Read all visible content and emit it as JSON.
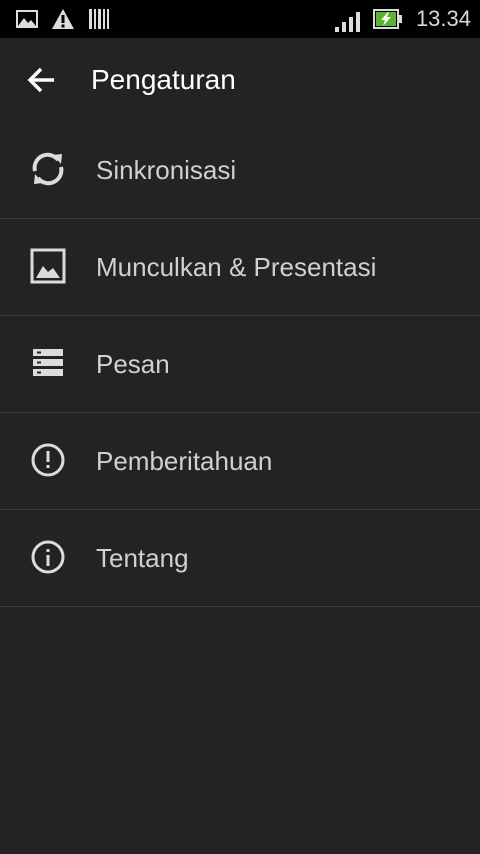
{
  "status_bar": {
    "time": "13.34",
    "left_icons": [
      "image-notification-icon",
      "warning-icon",
      "barcode-icon"
    ],
    "right_icons": [
      "signal-icon",
      "battery-charging-icon"
    ]
  },
  "app_bar": {
    "title": "Pengaturan",
    "back_icon": "arrow-left-icon"
  },
  "menu": {
    "items": [
      {
        "label": "Sinkronisasi",
        "icon": "sync-icon"
      },
      {
        "label": "Munculkan & Presentasi",
        "icon": "image-icon"
      },
      {
        "label": "Pesan",
        "icon": "list-icon"
      },
      {
        "label": "Pemberitahuan",
        "icon": "alert-circle-icon"
      },
      {
        "label": "Tentang",
        "icon": "info-circle-icon"
      }
    ]
  },
  "colors": {
    "background": "#232323",
    "status_bar": "#000000",
    "divider": "#3d3d3d",
    "text_primary": "#ffffff",
    "text_secondary": "#d0d0d0",
    "battery_green": "#5db32f"
  }
}
